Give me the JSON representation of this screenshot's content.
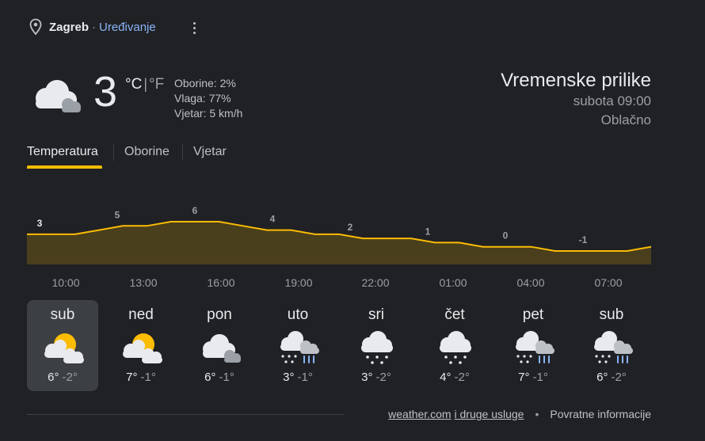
{
  "header": {
    "location": "Zagreb",
    "separator": "·",
    "edit_label": "Uređivanje"
  },
  "current": {
    "temperature": "3",
    "unit_c": "°C",
    "unit_divider": "|",
    "unit_f": "°F",
    "precipitation": "Oborine: 2%",
    "humidity": "Vlaga: 77%",
    "wind": "Vjetar: 5 km/h",
    "icon": "cloudy-icon"
  },
  "summary": {
    "title": "Vremenske prilike",
    "time": "subota 09:00",
    "condition": "Oblačno"
  },
  "tabs": [
    {
      "label": "Temperatura",
      "active": true
    },
    {
      "label": "Oborine",
      "active": false
    },
    {
      "label": "Vjetar",
      "active": false
    }
  ],
  "chart_data": {
    "type": "area",
    "title": "",
    "xlabel": "",
    "ylabel": "",
    "labeled_points": [
      {
        "hour": "10:00",
        "value": 3
      },
      {
        "hour": "13:00",
        "value": 5
      },
      {
        "hour": "16:00",
        "value": 6
      },
      {
        "hour": "19:00",
        "value": 4
      },
      {
        "hour": "22:00",
        "value": 2
      },
      {
        "hour": "01:00",
        "value": 1
      },
      {
        "hour": "04:00",
        "value": 0
      },
      {
        "hour": "07:00",
        "value": -1
      }
    ],
    "series": [
      {
        "values": [
          3,
          3,
          3,
          4,
          5,
          5,
          6,
          6,
          6,
          5,
          4,
          4,
          3,
          3,
          2,
          2,
          2,
          1,
          1,
          0,
          0,
          0,
          -1,
          -1,
          -1,
          -1,
          0
        ]
      }
    ],
    "x_labels": [
      "10:00",
      "13:00",
      "16:00",
      "19:00",
      "22:00",
      "01:00",
      "04:00",
      "07:00"
    ],
    "line_color": "#fbbc04",
    "fill_color": "#4a3f1c"
  },
  "days": [
    {
      "name": "sub",
      "high": "6°",
      "low": "-2°",
      "icon": "partly-sunny-icon",
      "selected": true
    },
    {
      "name": "ned",
      "high": "7°",
      "low": "-1°",
      "icon": "partly-sunny-icon",
      "selected": false
    },
    {
      "name": "pon",
      "high": "6°",
      "low": "-1°",
      "icon": "cloudy-icon",
      "selected": false
    },
    {
      "name": "uto",
      "high": "3°",
      "low": "-1°",
      "icon": "snow-rain-icon",
      "selected": false
    },
    {
      "name": "sri",
      "high": "3°",
      "low": "-2°",
      "icon": "snow-icon",
      "selected": false
    },
    {
      "name": "čet",
      "high": "4°",
      "low": "-2°",
      "icon": "snow-icon",
      "selected": false
    },
    {
      "name": "pet",
      "high": "7°",
      "low": "-1°",
      "icon": "snow-rain-icon",
      "selected": false
    },
    {
      "name": "sub",
      "high": "6°",
      "low": "-2°",
      "icon": "snow-rain-icon",
      "selected": false
    }
  ],
  "footer": {
    "source_link": "weather.com",
    "other_link": "i druge usluge",
    "bullet": "•",
    "feedback": "Povratne informacije"
  }
}
